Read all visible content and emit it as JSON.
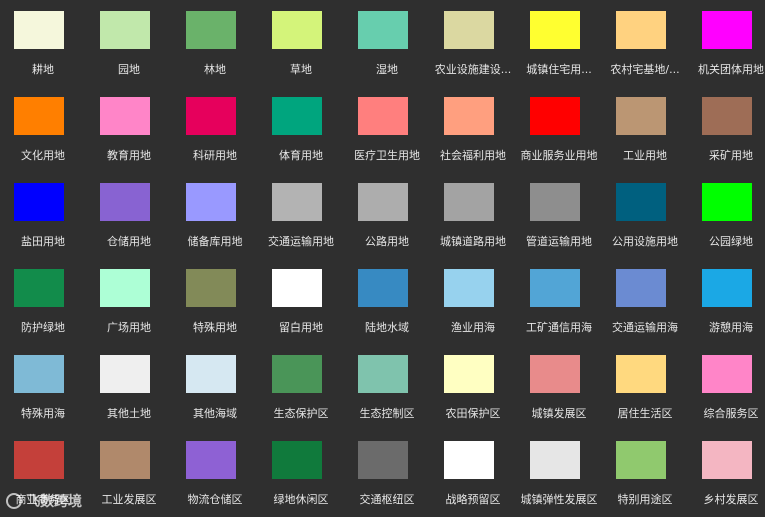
{
  "swatches": [
    {
      "label": "耕地",
      "color": "#f5f7dc"
    },
    {
      "label": "园地",
      "color": "#c1e8ab"
    },
    {
      "label": "林地",
      "color": "#6ab26a"
    },
    {
      "label": "草地",
      "color": "#d4f47a"
    },
    {
      "label": "湿地",
      "color": "#67ceae"
    },
    {
      "label": "农业设施建设...",
      "color": "#dbd8a1"
    },
    {
      "label": "城镇住宅用...",
      "color": "#ffff30"
    },
    {
      "label": "农村宅基地/...",
      "color": "#ffd280"
    },
    {
      "label": "机关团体用地",
      "color": "#ff00ff"
    },
    {
      "label": "文化用地",
      "color": "#ff7f00"
    },
    {
      "label": "教育用地",
      "color": "#ff85c8"
    },
    {
      "label": "科研用地",
      "color": "#e6005c"
    },
    {
      "label": "体育用地",
      "color": "#00a57e"
    },
    {
      "label": "医疗卫生用地",
      "color": "#ff7f7e"
    },
    {
      "label": "社会福利用地",
      "color": "#ff9f7f"
    },
    {
      "label": "商业服务业用地",
      "color": "#ff0000"
    },
    {
      "label": "工业用地",
      "color": "#bb9673"
    },
    {
      "label": "采矿用地",
      "color": "#9e6d56"
    },
    {
      "label": "盐田用地",
      "color": "#0000ff"
    },
    {
      "label": "仓储用地",
      "color": "#8863d2"
    },
    {
      "label": "储备库用地",
      "color": "#9999ff"
    },
    {
      "label": "交通运输用地",
      "color": "#b3b3b3"
    },
    {
      "label": "公路用地",
      "color": "#adadad"
    },
    {
      "label": "城镇道路用地",
      "color": "#a3a3a3"
    },
    {
      "label": "管道运输用地",
      "color": "#8e8e8e"
    },
    {
      "label": "公用设施用地",
      "color": "#00607f"
    },
    {
      "label": "公园绿地",
      "color": "#00ff00"
    },
    {
      "label": "防护绿地",
      "color": "#128c4b"
    },
    {
      "label": "广场用地",
      "color": "#adffd6"
    },
    {
      "label": "特殊用地",
      "color": "#828a58"
    },
    {
      "label": "留白用地",
      "color": "#ffffff"
    },
    {
      "label": "陆地水域",
      "color": "#378ac2"
    },
    {
      "label": "渔业用海",
      "color": "#97d2ee"
    },
    {
      "label": "工矿通信用海",
      "color": "#52a5d6"
    },
    {
      "label": "交通运输用海",
      "color": "#6b8bd2"
    },
    {
      "label": "游憩用海",
      "color": "#1ba8e5"
    },
    {
      "label": "特殊用海",
      "color": "#7fbad6"
    },
    {
      "label": "其他土地",
      "color": "#efefef"
    },
    {
      "label": "其他海域",
      "color": "#d6e8f2"
    },
    {
      "label": "生态保护区",
      "color": "#4a9558"
    },
    {
      "label": "生态控制区",
      "color": "#7fc3ad"
    },
    {
      "label": "农田保护区",
      "color": "#ffffc2"
    },
    {
      "label": "城镇发展区",
      "color": "#e88b8b"
    },
    {
      "label": "居住生活区",
      "color": "#ffd97f"
    },
    {
      "label": "综合服务区",
      "color": "#ff85c8"
    },
    {
      "label": "商业商务区",
      "color": "#c4403a"
    },
    {
      "label": "工业发展区",
      "color": "#b0896b"
    },
    {
      "label": "物流仓储区",
      "color": "#8e61d4"
    },
    {
      "label": "绿地休闲区",
      "color": "#107a3c"
    },
    {
      "label": "交通枢纽区",
      "color": "#6b6b6b"
    },
    {
      "label": "战略预留区",
      "color": "#ffffff"
    },
    {
      "label": "城镇弹性发展区",
      "color": "#e6e6e6"
    },
    {
      "label": "特别用途区",
      "color": "#90c96e"
    },
    {
      "label": "乡村发展区",
      "color": "#f4b6c2"
    }
  ],
  "watermark": {
    "text": "飞数跨境"
  }
}
